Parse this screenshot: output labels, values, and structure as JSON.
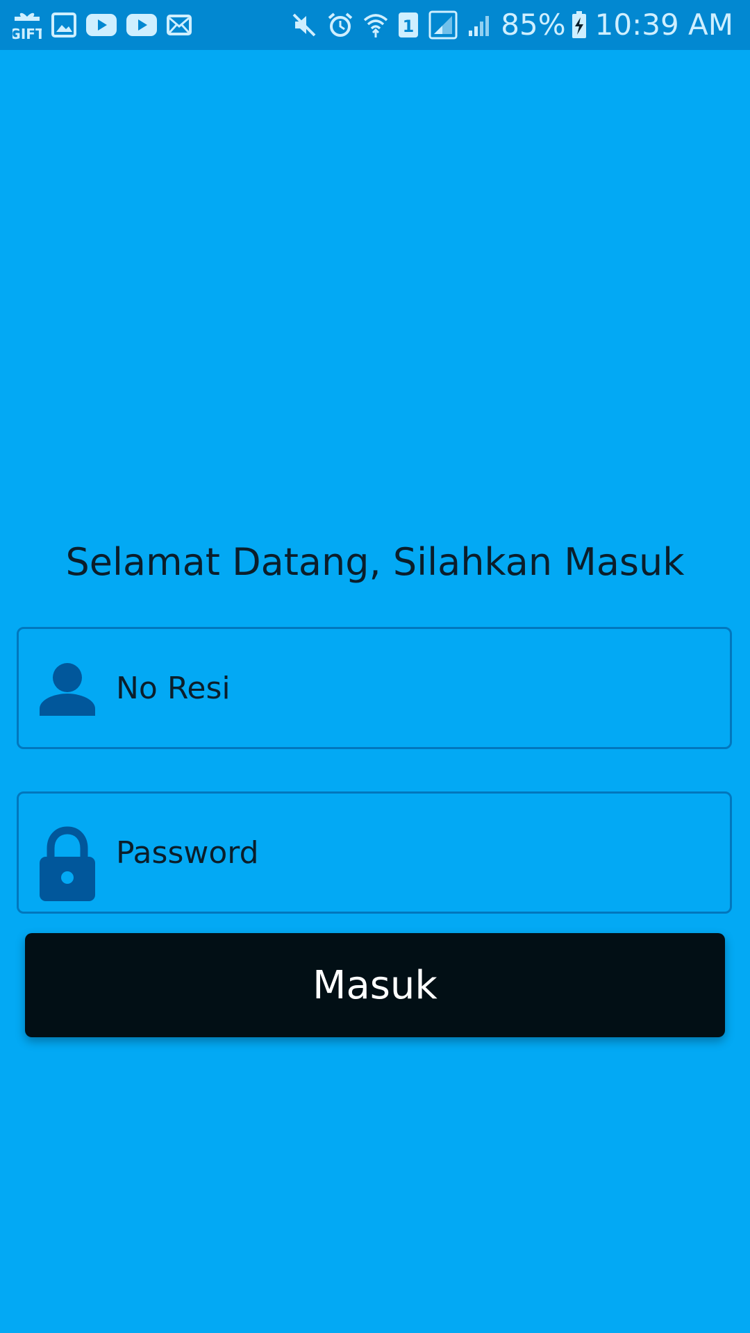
{
  "status_bar": {
    "left_icons": [
      "gift-icon",
      "image-icon",
      "youtube-icon",
      "youtube-icon",
      "mail-icon"
    ],
    "right_icons": [
      "mute-icon",
      "alarm-icon",
      "wifi-icon",
      "sim-1-icon",
      "signal-icon",
      "signal-icon",
      "battery-charging-icon"
    ],
    "battery": "85%",
    "time": "10:39 AM",
    "color": "#0288D1"
  },
  "welcome_text": "Selamat Datang, Silahkan Masuk",
  "fields": {
    "resi": {
      "placeholder": "No Resi",
      "icon": "person-icon"
    },
    "password": {
      "placeholder": "Password",
      "icon": "lock-icon"
    }
  },
  "login_button": {
    "label": "Masuk"
  },
  "colors": {
    "background": "#03A9F4",
    "field_border": "#0277BD",
    "icon": "#01579B",
    "button": "#020F15",
    "text": "#0B1E2B"
  }
}
